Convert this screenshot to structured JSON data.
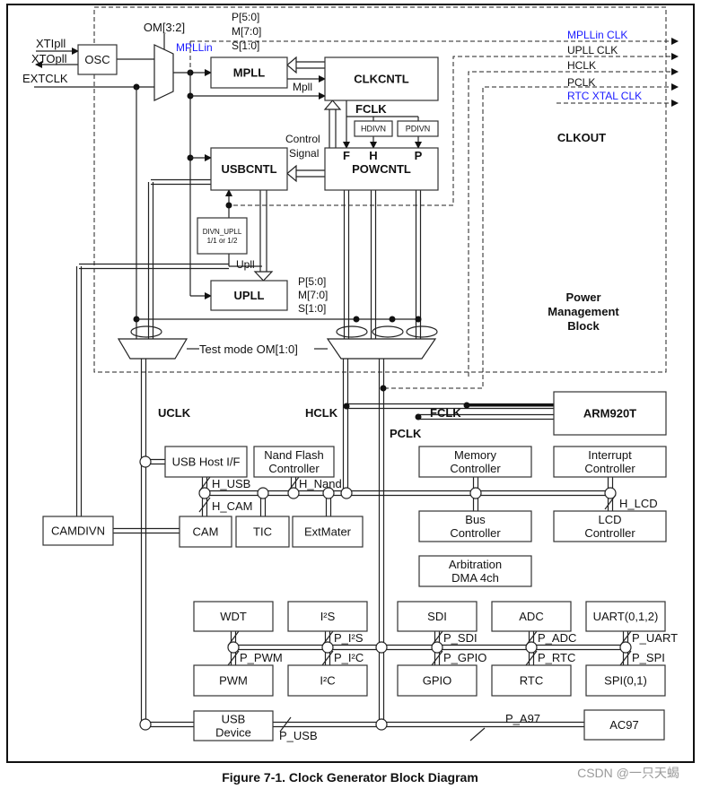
{
  "caption": "Figure 7-1. Clock Generator Block Diagram",
  "watermark": "CSDN @一只天蝎",
  "colors": {
    "line": "#222222",
    "highlight": "#1a1aff",
    "watermark": "#9a9a9a"
  },
  "blocks": {
    "osc": [
      "OSC"
    ],
    "mpll": [
      "MPLL"
    ],
    "clkcntl": [
      "CLKCNTL"
    ],
    "powcntl": [
      "POWCNTL"
    ],
    "usbcntl": [
      "USBCNTL"
    ],
    "hdivn": [
      "HDIVN"
    ],
    "pdivn": [
      "PDIVN"
    ],
    "divn_upll": [
      "DIVN_UPLL",
      "1/1 or 1/2"
    ],
    "upll": [
      "UPLL"
    ],
    "arm": [
      "ARM920T"
    ],
    "usb_host": [
      "USB Host I/F"
    ],
    "nand": [
      "Nand Flash",
      "Controller"
    ],
    "memory": [
      "Memory",
      "Controller"
    ],
    "interrupt": [
      "Interrupt",
      "Controller"
    ],
    "camdivn": [
      "CAMDIVN"
    ],
    "cam": [
      "CAM"
    ],
    "tic": [
      "TIC"
    ],
    "extmater": [
      "ExtMater"
    ],
    "bus": [
      "Bus",
      "Controller"
    ],
    "lcd": [
      "LCD",
      "Controller"
    ],
    "dma": [
      "Arbitration",
      "DMA 4ch"
    ],
    "wdt": [
      "WDT"
    ],
    "i2s": [
      "I²S"
    ],
    "sdi": [
      "SDI"
    ],
    "adc": [
      "ADC"
    ],
    "uart": [
      "UART(0,1,2)"
    ],
    "pwm": [
      "PWM"
    ],
    "i2c": [
      "I²C"
    ],
    "gpio": [
      "GPIO"
    ],
    "rtc": [
      "RTC"
    ],
    "spi": [
      "SPI(0,1)"
    ],
    "usb_device": [
      "USB",
      "Device"
    ],
    "ac97": [
      "AC97"
    ]
  },
  "signals": {
    "xtipll": "XTIpll",
    "xtopll": "XTOpll",
    "extclk": "EXTCLK",
    "om32": "OM[3:2]",
    "mpllin": "MPLLin",
    "p50": "P[5:0]",
    "m70": "M[7:0]",
    "s10": "S[1:0]",
    "mpll_out": "Mpll",
    "fclk": "FCLK",
    "f": "F",
    "h": "H",
    "p": "P",
    "control": "Control",
    "signal": "Signal",
    "upll_out": "Upll",
    "test_mode": "Test mode OM[1:0]",
    "uclk": "UCLK",
    "hclk": "HCLK",
    "pclk": "PCLK",
    "fclk_arm": "FCLK",
    "clkout": "CLKOUT",
    "pmb": [
      "Power",
      "Management",
      "Block"
    ]
  },
  "clkout_list": [
    "MPLLin CLK",
    "UPLL CLK",
    "HCLK",
    "PCLK",
    "RTC XTAL CLK"
  ],
  "bus_labels": {
    "h_usb": "H_USB",
    "h_nand": "H_Nand",
    "h_cam": "H_CAM",
    "h_lcd": "H_LCD",
    "p_pwm": "P_PWM",
    "p_i2s": "P_I²S",
    "p_i2c": "P_I²C",
    "p_sdi": "P_SDI",
    "p_gpio": "P_GPIO",
    "p_adc": "P_ADC",
    "p_rtc": "P_RTC",
    "p_uart": "P_UART",
    "p_spi": "P_SPI",
    "p_usb": "P_USB",
    "p_a97": "P_A97"
  }
}
